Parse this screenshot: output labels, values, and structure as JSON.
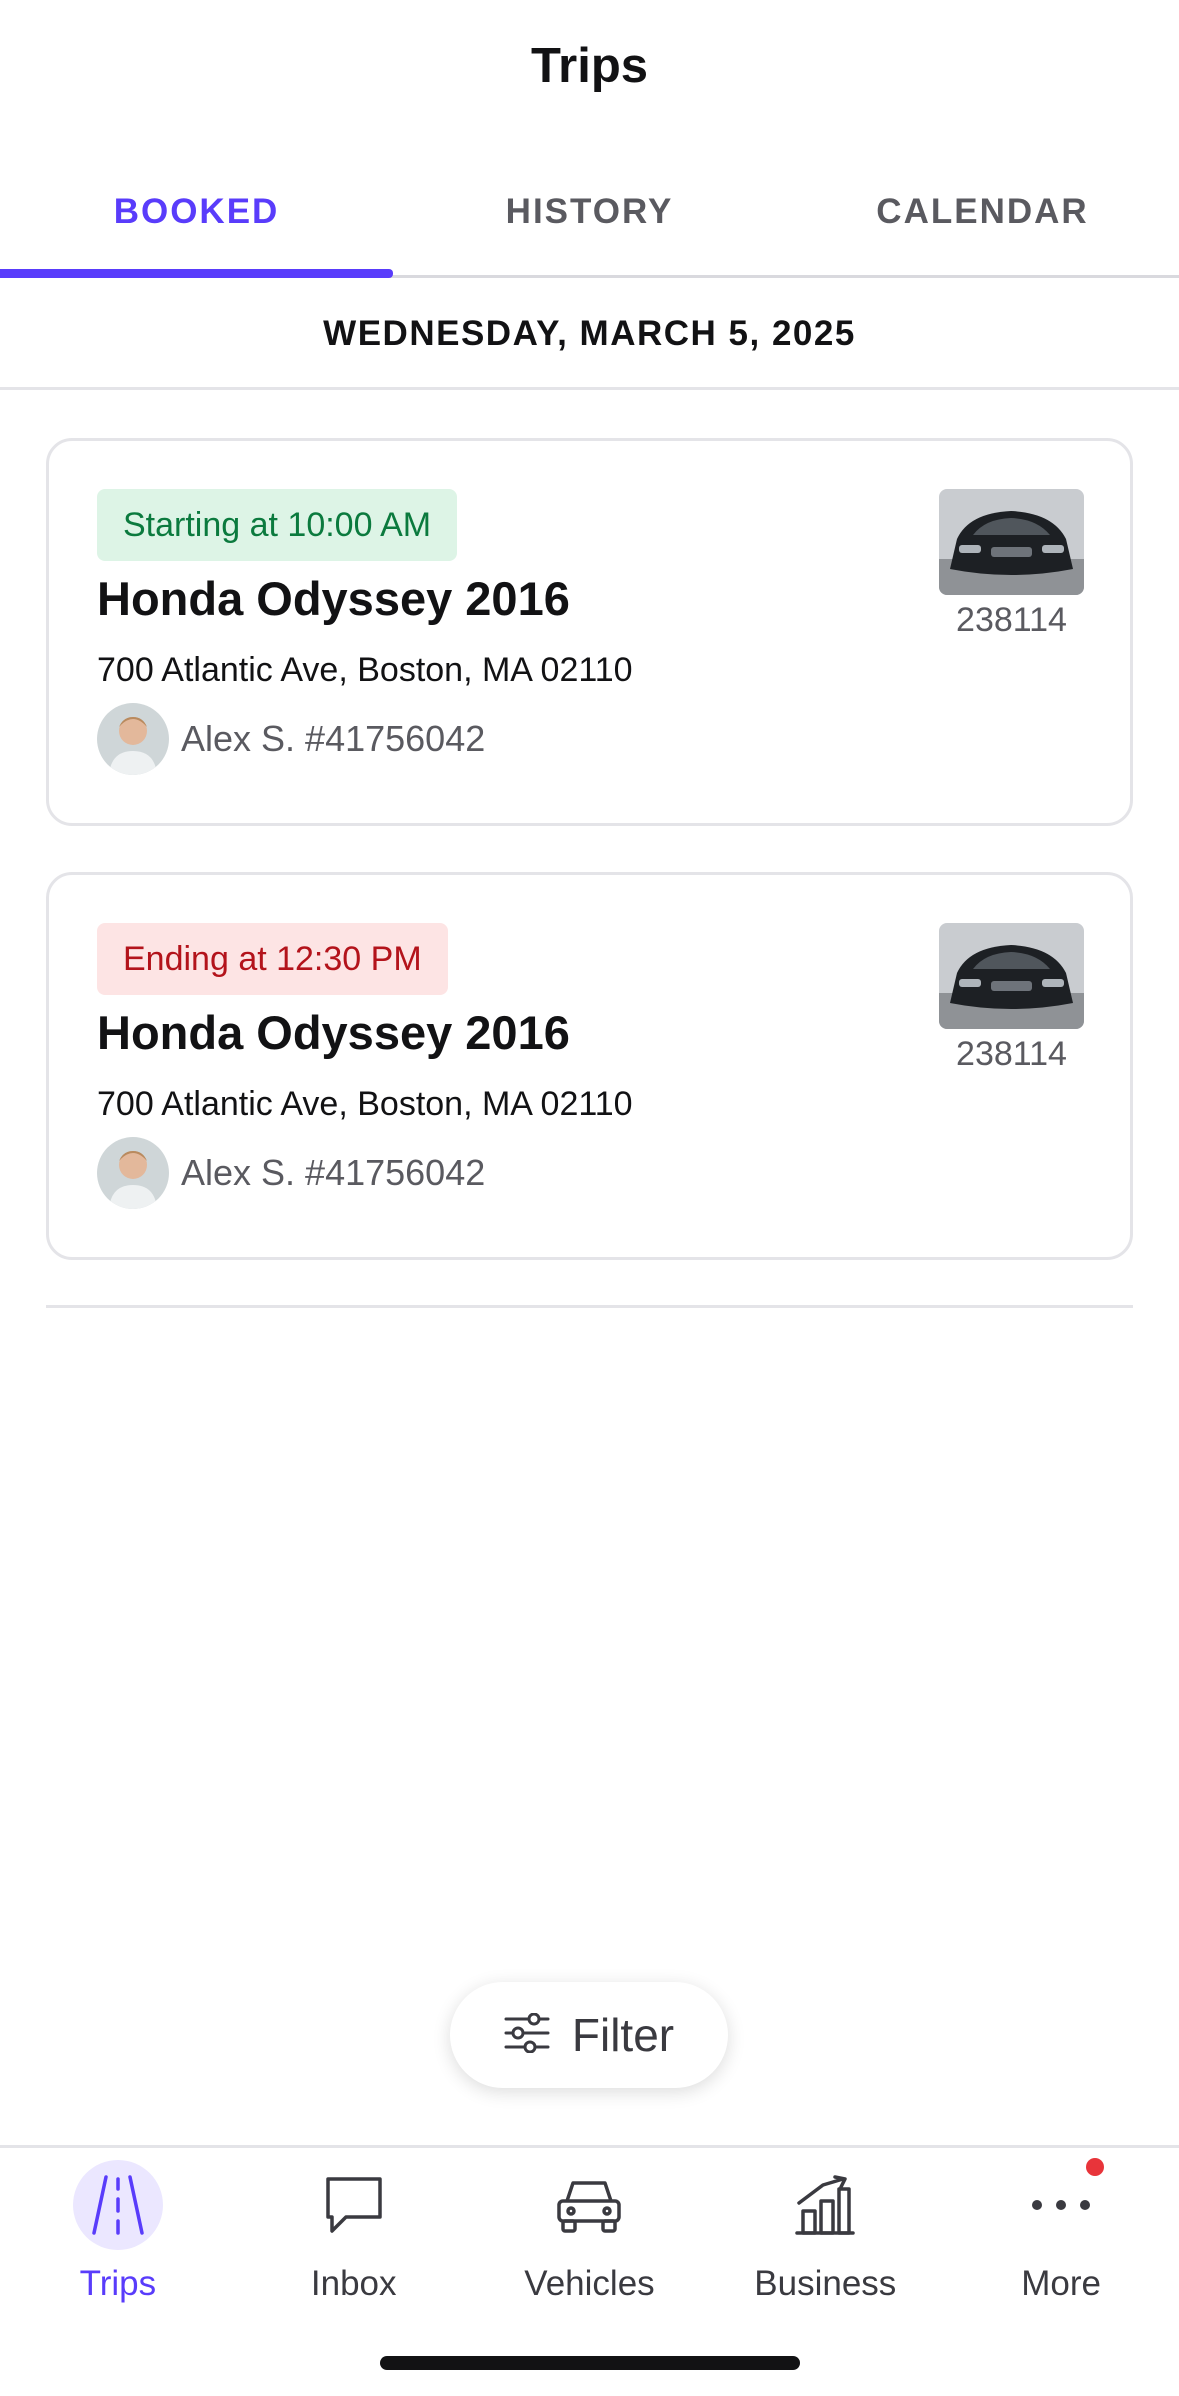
{
  "header": {
    "title": "Trips"
  },
  "tabs": [
    {
      "label": "BOOKED",
      "active": true
    },
    {
      "label": "HISTORY",
      "active": false
    },
    {
      "label": "CALENDAR",
      "active": false
    }
  ],
  "date_header": "WEDNESDAY, MARCH 5, 2025",
  "trips": [
    {
      "status": "Starting at 10:00 AM",
      "status_type": "start",
      "vehicle": "Honda Odyssey 2016",
      "address": "700 Atlantic Ave, Boston, MA 02110",
      "guest": "Alex S. #41756042",
      "plate": "238114",
      "icons": {
        "avatar": "guest-avatar",
        "thumbnail": "car-thumbnail"
      }
    },
    {
      "status": "Ending at 12:30 PM",
      "status_type": "end",
      "vehicle": "Honda Odyssey 2016",
      "address": "700 Atlantic Ave, Boston, MA 02110",
      "guest": "Alex S. #41756042",
      "plate": "238114",
      "icons": {
        "avatar": "guest-avatar",
        "thumbnail": "car-thumbnail"
      }
    }
  ],
  "filter": {
    "label": "Filter",
    "icon": "sliders-icon"
  },
  "bottom_nav": [
    {
      "label": "Trips",
      "icon": "road-icon",
      "active": true
    },
    {
      "label": "Inbox",
      "icon": "chat-bubble-icon",
      "active": false
    },
    {
      "label": "Vehicles",
      "icon": "car-icon",
      "active": false
    },
    {
      "label": "Business",
      "icon": "bar-chart-icon",
      "active": false
    },
    {
      "label": "More",
      "icon": "ellipsis-icon",
      "active": false,
      "badge": true
    }
  ],
  "colors": {
    "accent": "#593cfb",
    "start_badge_bg": "#ddf4e6",
    "start_badge_text": "#0b7a3e",
    "end_badge_bg": "#fde4e4",
    "end_badge_text": "#b3131b",
    "notification": "#e8343a"
  }
}
